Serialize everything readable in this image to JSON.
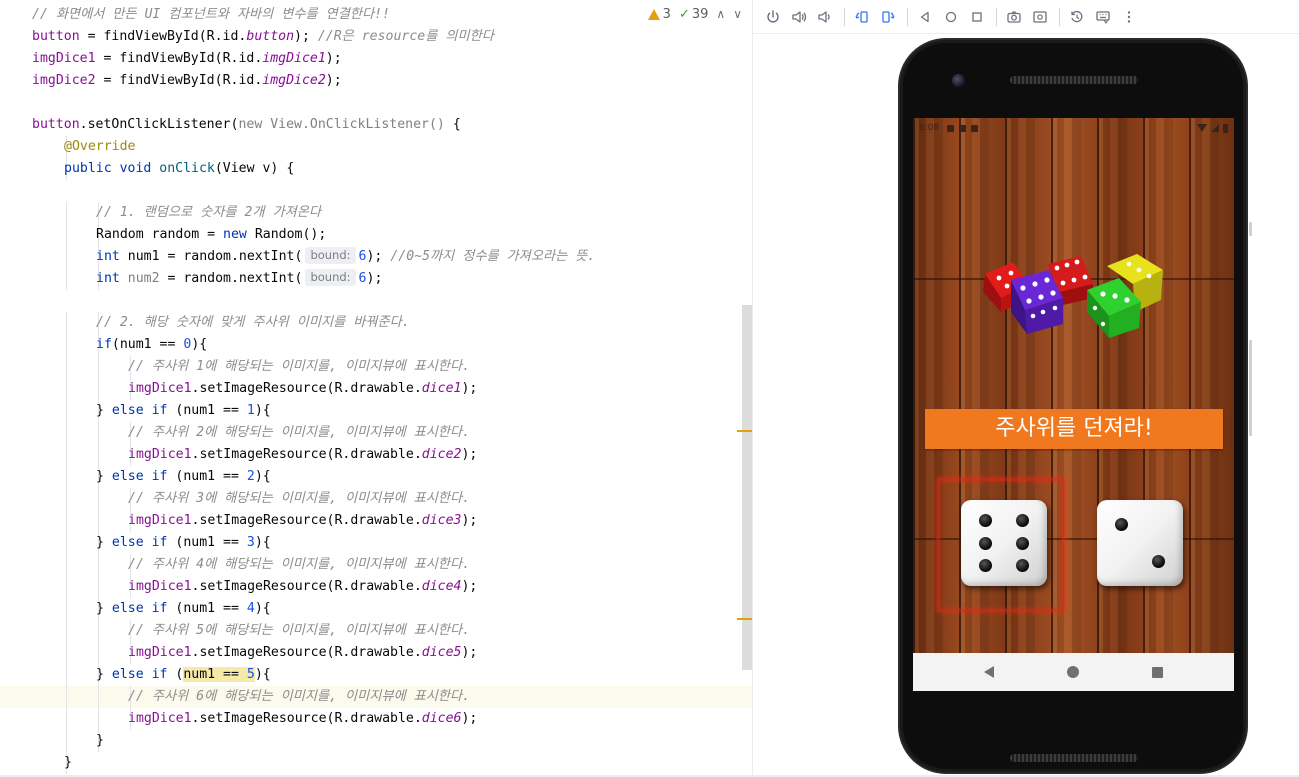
{
  "editor": {
    "inspection": {
      "warnings": "3",
      "passed": "39",
      "warning_color": "#e3a00c",
      "ok_color": "#3b9b3b"
    },
    "current_line_index": 31,
    "lines": [
      {
        "indent": 1,
        "segs": [
          {
            "t": "// 화면에서 만든 UI 컴포넌트와 자바의 변수를 연결한다!!",
            "c": "comment"
          }
        ]
      },
      {
        "indent": 1,
        "segs": [
          {
            "t": "button",
            "c": "field"
          },
          {
            "t": " = findViewById(R.id."
          },
          {
            "t": "button",
            "c": "ifield"
          },
          {
            "t": "); "
          },
          {
            "t": "//R은 resource를 의미한다",
            "c": "comment"
          }
        ]
      },
      {
        "indent": 1,
        "segs": [
          {
            "t": "imgDice1",
            "c": "field"
          },
          {
            "t": " = findViewById(R.id."
          },
          {
            "t": "imgDice1",
            "c": "ifield"
          },
          {
            "t": ");"
          }
        ]
      },
      {
        "indent": 1,
        "segs": [
          {
            "t": "imgDice2",
            "c": "field"
          },
          {
            "t": " = findViewById(R.id."
          },
          {
            "t": "imgDice2",
            "c": "ifield"
          },
          {
            "t": ");"
          }
        ]
      },
      {
        "indent": 0,
        "segs": []
      },
      {
        "indent": 1,
        "segs": [
          {
            "t": "button",
            "c": "field"
          },
          {
            "t": ".setOnClickListener("
          },
          {
            "t": "new View.OnClickListener()",
            "c": "param"
          },
          {
            "t": " {"
          }
        ]
      },
      {
        "indent": 2,
        "segs": [
          {
            "t": "@Override",
            "c": "annotation"
          }
        ]
      },
      {
        "indent": 2,
        "segs": [
          {
            "t": "public void ",
            "c": "keyword"
          },
          {
            "t": "onClick",
            "c": "method"
          },
          {
            "t": "(View v) {"
          }
        ]
      },
      {
        "indent": 0,
        "segs": []
      },
      {
        "indent": 3,
        "segs": [
          {
            "t": "// 1. 랜덤으로 숫자를 2개 가져온다",
            "c": "comment"
          }
        ]
      },
      {
        "indent": 3,
        "segs": [
          {
            "t": "Random random = "
          },
          {
            "t": "new ",
            "c": "keyword"
          },
          {
            "t": "Random();"
          }
        ]
      },
      {
        "indent": 3,
        "segs": [
          {
            "t": "int ",
            "c": "keyword"
          },
          {
            "t": "num1 = random.nextInt("
          },
          {
            "t": "bound:",
            "c": "hint"
          },
          {
            "t": "6",
            "c": "number"
          },
          {
            "t": "); "
          },
          {
            "t": "//0~5까지 정수를 가져오라는 뜻.",
            "c": "comment"
          }
        ]
      },
      {
        "indent": 3,
        "segs": [
          {
            "t": "int ",
            "c": "keyword"
          },
          {
            "t": "num2",
            "c": "param"
          },
          {
            "t": " = random.nextInt("
          },
          {
            "t": "bound:",
            "c": "hint"
          },
          {
            "t": "6",
            "c": "number"
          },
          {
            "t": ");"
          }
        ]
      },
      {
        "indent": 0,
        "segs": []
      },
      {
        "indent": 3,
        "segs": [
          {
            "t": "// 2. 해당 숫자에 맞게 주사위 이미지를 바꿔준다.",
            "c": "comment"
          }
        ]
      },
      {
        "indent": 3,
        "segs": [
          {
            "t": "if",
            "c": "keyword"
          },
          {
            "t": "(num1 == "
          },
          {
            "t": "0",
            "c": "number"
          },
          {
            "t": "){"
          }
        ]
      },
      {
        "indent": 4,
        "segs": [
          {
            "t": "// 주사위 1에 해당되는 이미지를, 이미지뷰에 표시한다.",
            "c": "comment"
          }
        ]
      },
      {
        "indent": 4,
        "segs": [
          {
            "t": "imgDice1",
            "c": "field"
          },
          {
            "t": ".setImageResource(R.drawable."
          },
          {
            "t": "dice1",
            "c": "ifield"
          },
          {
            "t": ");"
          }
        ]
      },
      {
        "indent": 3,
        "segs": [
          {
            "t": "} "
          },
          {
            "t": "else if",
            "c": "keyword"
          },
          {
            "t": " (num1 == "
          },
          {
            "t": "1",
            "c": "number"
          },
          {
            "t": "){"
          }
        ]
      },
      {
        "indent": 4,
        "segs": [
          {
            "t": "// 주사위 2에 해당되는 이미지를, 이미지뷰에 표시한다.",
            "c": "comment"
          }
        ]
      },
      {
        "indent": 4,
        "segs": [
          {
            "t": "imgDice1",
            "c": "field"
          },
          {
            "t": ".setImageResource(R.drawable."
          },
          {
            "t": "dice2",
            "c": "ifield"
          },
          {
            "t": ");"
          }
        ]
      },
      {
        "indent": 3,
        "segs": [
          {
            "t": "} "
          },
          {
            "t": "else if",
            "c": "keyword"
          },
          {
            "t": " (num1 == "
          },
          {
            "t": "2",
            "c": "number"
          },
          {
            "t": "){"
          }
        ]
      },
      {
        "indent": 4,
        "segs": [
          {
            "t": "// 주사위 3에 해당되는 이미지를, 이미지뷰에 표시한다.",
            "c": "comment"
          }
        ]
      },
      {
        "indent": 4,
        "segs": [
          {
            "t": "imgDice1",
            "c": "field"
          },
          {
            "t": ".setImageResource(R.drawable."
          },
          {
            "t": "dice3",
            "c": "ifield"
          },
          {
            "t": ");"
          }
        ]
      },
      {
        "indent": 3,
        "segs": [
          {
            "t": "} "
          },
          {
            "t": "else if",
            "c": "keyword"
          },
          {
            "t": " (num1 == "
          },
          {
            "t": "3",
            "c": "number"
          },
          {
            "t": "){"
          }
        ]
      },
      {
        "indent": 4,
        "segs": [
          {
            "t": "// 주사위 4에 해당되는 이미지를, 이미지뷰에 표시한다.",
            "c": "comment"
          }
        ]
      },
      {
        "indent": 4,
        "segs": [
          {
            "t": "imgDice1",
            "c": "field"
          },
          {
            "t": ".setImageResource(R.drawable."
          },
          {
            "t": "dice4",
            "c": "ifield"
          },
          {
            "t": ");"
          }
        ]
      },
      {
        "indent": 3,
        "segs": [
          {
            "t": "} "
          },
          {
            "t": "else if",
            "c": "keyword"
          },
          {
            "t": " (num1 == "
          },
          {
            "t": "4",
            "c": "number"
          },
          {
            "t": "){"
          }
        ]
      },
      {
        "indent": 4,
        "segs": [
          {
            "t": "// 주사위 5에 해당되는 이미지를, 이미지뷰에 표시한다.",
            "c": "comment"
          }
        ]
      },
      {
        "indent": 4,
        "segs": [
          {
            "t": "imgDice1",
            "c": "field"
          },
          {
            "t": ".setImageResource(R.drawable."
          },
          {
            "t": "dice5",
            "c": "ifield"
          },
          {
            "t": ");"
          }
        ]
      },
      {
        "indent": 3,
        "segs": [
          {
            "t": "} "
          },
          {
            "t": "else if",
            "c": "keyword"
          },
          {
            "t": " ("
          },
          {
            "t": "num1 == ",
            "c": "highlight"
          },
          {
            "t": "5",
            "c": "numhl"
          },
          {
            "t": "){"
          }
        ]
      },
      {
        "indent": 4,
        "segs": [
          {
            "t": "// 주사위 6에 해당되는 이미지를, 이미지뷰에 표시한다.",
            "c": "comment"
          }
        ]
      },
      {
        "indent": 4,
        "segs": [
          {
            "t": "imgDice1",
            "c": "field"
          },
          {
            "t": ".setImageResource(R.drawable."
          },
          {
            "t": "dice6",
            "c": "ifield"
          },
          {
            "t": ");"
          }
        ]
      },
      {
        "indent": 3,
        "segs": [
          {
            "t": "}"
          }
        ]
      },
      {
        "indent": 2,
        "segs": [
          {
            "t": "}"
          }
        ]
      }
    ]
  },
  "emulator": {
    "toolbar": [
      {
        "name": "power-icon",
        "group": 1
      },
      {
        "name": "volume-up-icon",
        "group": 1
      },
      {
        "name": "volume-down-icon",
        "group": 1
      },
      {
        "name": "rotate-left-icon",
        "group": 2
      },
      {
        "name": "rotate-right-icon",
        "group": 2
      },
      {
        "name": "back-icon",
        "group": 3
      },
      {
        "name": "home-icon",
        "group": 3
      },
      {
        "name": "overview-icon",
        "group": 3
      },
      {
        "name": "camera-icon",
        "group": 4
      },
      {
        "name": "zoom-icon",
        "group": 4
      },
      {
        "name": "snapshot-icon",
        "group": 5
      },
      {
        "name": "keyboard-icon",
        "group": 5
      },
      {
        "name": "more-icon",
        "group": 5
      }
    ],
    "app": {
      "status_time": "6:08",
      "roll_button_label": "주사위를 던져라!",
      "dice1_value": 6,
      "dice2_value": 2,
      "button_color": "#f0781e"
    }
  }
}
